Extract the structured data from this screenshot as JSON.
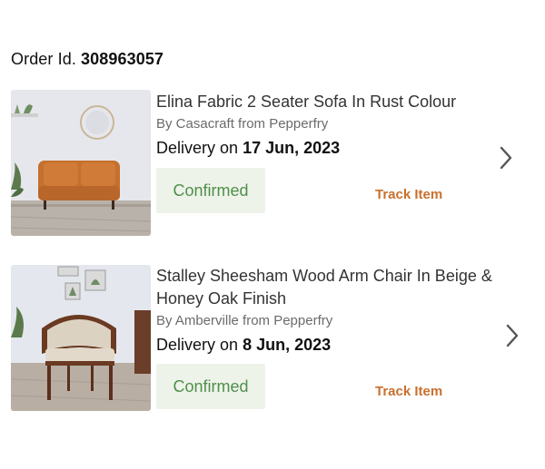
{
  "order": {
    "label": "Order Id.",
    "number": "308963057"
  },
  "items": [
    {
      "title": "Elina Fabric 2 Seater Sofa In Rust Colour",
      "brand": "By Casacraft from Pepperfry",
      "delivery_prefix": "Delivery on",
      "delivery_date": "17 Jun, 2023",
      "status": "Confirmed",
      "action": "Track Item",
      "icon": "chevron-right-icon"
    },
    {
      "title": "Stalley Sheesham Wood Arm Chair In Beige & Honey Oak Finish",
      "brand": "By Amberville from Pepperfry",
      "delivery_prefix": "Delivery on",
      "delivery_date": "8 Jun, 2023",
      "status": "Confirmed",
      "action": "Track Item",
      "icon": "chevron-right-icon"
    }
  ],
  "colors": {
    "status_text": "#4f8f4a",
    "status_bg": "#eef3ea",
    "action": "#c8702e"
  }
}
